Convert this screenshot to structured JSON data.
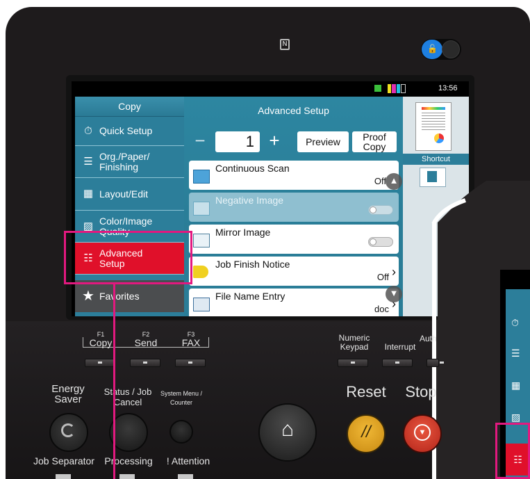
{
  "statusbar": {
    "time": "13:56"
  },
  "left_menu": {
    "title": "Copy",
    "items": [
      {
        "label": "Quick Setup",
        "icon": "timer-icon"
      },
      {
        "label": "Org./Paper/ Finishing",
        "icon": "paper-stack-icon"
      },
      {
        "label": "Layout/Edit",
        "icon": "layout-icon"
      },
      {
        "label": "Color/Image Quality",
        "icon": "image-icon"
      },
      {
        "label": "Advanced Setup",
        "icon": "sliders-icon"
      },
      {
        "label": "Favorites",
        "icon": "star-icon"
      }
    ]
  },
  "main": {
    "title": "Advanced Setup",
    "copies": "1",
    "minus": "−",
    "plus": "+",
    "preview_label": "Preview",
    "proof_copy_label": "Proof Copy",
    "rows": [
      {
        "name": "Continuous Scan",
        "value": "Off"
      },
      {
        "name": "Negative Image"
      },
      {
        "name": "Mirror Image"
      },
      {
        "name": "Job Finish Notice",
        "value": "Off"
      },
      {
        "name": "File Name Entry",
        "value": "doc"
      }
    ]
  },
  "right_panel": {
    "shortcut_label": "Shortcut"
  },
  "function_keys": [
    {
      "key": "F1",
      "label": "Copy"
    },
    {
      "key": "F2",
      "label": "Send"
    },
    {
      "key": "F3",
      "label": "FAX"
    }
  ],
  "keys": {
    "numeric_keypad": "Numeric Keypad",
    "interrupt": "Interrupt",
    "auth": "Auth",
    "energy_saver": "Energy Saver",
    "status_job_cancel": "Status / Job Cancel",
    "system_menu_counter": "System Menu / Counter",
    "reset": "Reset",
    "stop": "Stop",
    "job_separator": "Job Separator",
    "processing": "Processing",
    "attention": "! Attention"
  },
  "colors": {
    "accent_red": "#e0102a",
    "highlight_pink": "#e2197f",
    "nav_blue": "#2c7e9a",
    "reset_yellow": "#e0a524",
    "stop_red": "#d83a2a"
  }
}
